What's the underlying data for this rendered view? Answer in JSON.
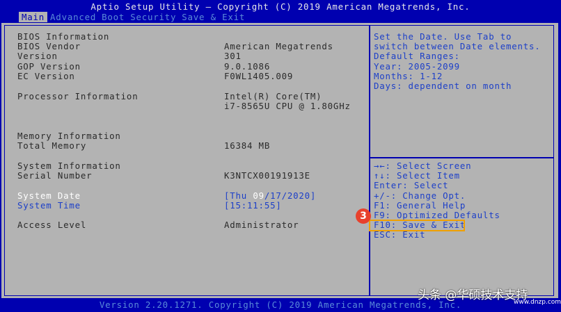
{
  "header": {
    "title": "Aptio Setup Utility – Copyright (C) 2019 American Megatrends, Inc.",
    "tabs": [
      "Main",
      "Advanced",
      "Boot",
      "Security",
      "Save & Exit"
    ],
    "active_tab": "Main"
  },
  "info": {
    "bios_information": "BIOS Information",
    "bios_vendor_label": "BIOS Vendor",
    "bios_vendor_value": "American Megatrends",
    "version_label": "Version",
    "version_value": "301",
    "gop_version_label": "GOP Version",
    "gop_version_value": "9.0.1086",
    "ec_version_label": "EC Version",
    "ec_version_value": "F0WL1405.009",
    "processor_information_label": "Processor Information",
    "processor_line1": "Intel(R) Core(TM)",
    "processor_line2": "i7-8565U CPU @ 1.80GHz",
    "memory_information": "Memory Information",
    "total_memory_label": "Total Memory",
    "total_memory_value": "16384 MB",
    "system_information": "System Information",
    "serial_number_label": "Serial Number",
    "serial_number_value": "K3NTCX00191913E",
    "system_date_label": "System Date",
    "system_date_value_prefix": "[Thu ",
    "system_date_value_highlight": "09",
    "system_date_value_suffix": "/17/2020]",
    "system_time_label": "System Time",
    "system_time_value": "[15:11:55]",
    "access_level_label": "Access Level",
    "access_level_value": "Administrator"
  },
  "help": {
    "lines": [
      "Set the Date. Use Tab to",
      "switch between Date elements.",
      "Default Ranges:",
      "Year: 2005-2099",
      "Months: 1-12",
      "Days: dependent on month"
    ]
  },
  "keys": {
    "lines": [
      "→←: Select Screen",
      "↑↓: Select Item",
      "Enter: Select",
      "+/-: Change Opt.",
      "F1: General Help",
      "F9: Optimized Defaults",
      "F10: Save & Exit",
      "ESC: Exit"
    ]
  },
  "annotation": {
    "badge": "3",
    "highlight_color": "#f0a000",
    "badge_color": "#e8412c"
  },
  "footer": {
    "text": "Version 2.20.1271. Copyright (C) 2019 American Megatrends, Inc."
  },
  "watermark": {
    "text": "头条 @华硕技术支持",
    "site": "www.dnzp.com"
  },
  "colors": {
    "background_blue": "#0000b0",
    "panel_gray": "#b3b3b3",
    "help_text_blue": "#1c3fc8"
  }
}
